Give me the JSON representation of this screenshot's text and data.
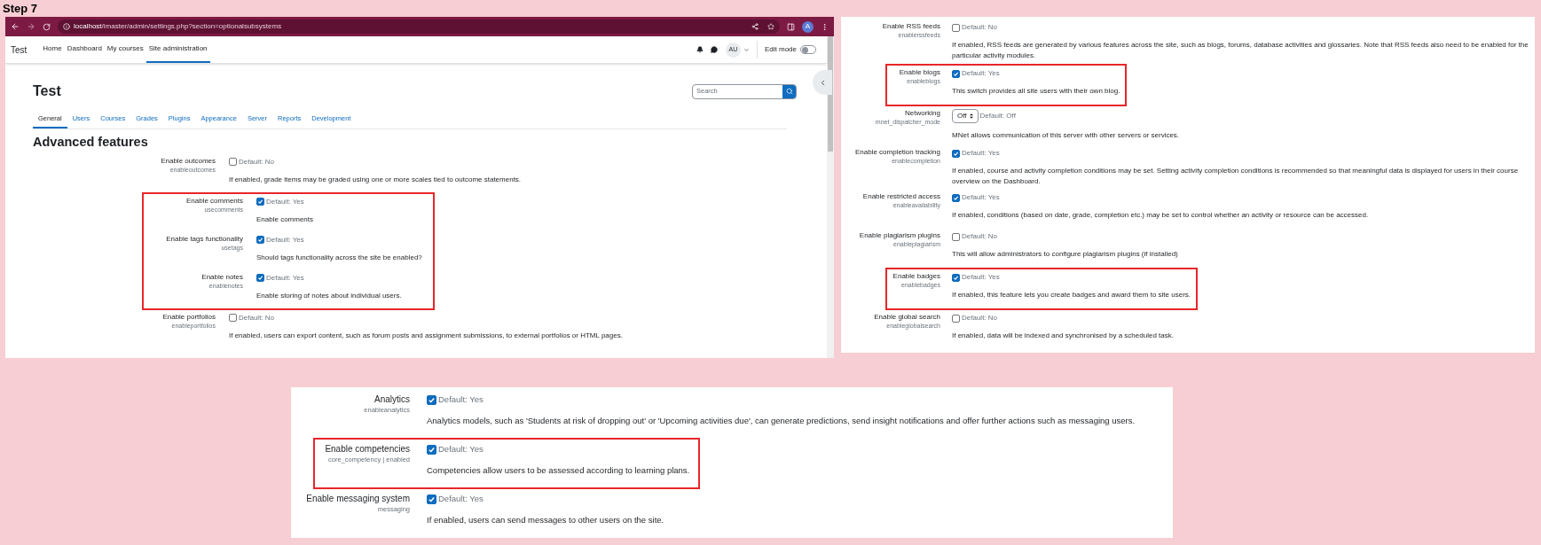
{
  "step_label": "Step 7",
  "browser": {
    "url_host": "localhost",
    "url_path": "/imaster/admin/settings.php?section=optionalsubsystems",
    "profile_initial": "A"
  },
  "navbar": {
    "brand": "Test",
    "items": [
      {
        "label": "Home",
        "selected": false
      },
      {
        "label": "Dashboard",
        "selected": false
      },
      {
        "label": "My courses",
        "selected": false
      },
      {
        "label": "Site administration",
        "selected": true
      }
    ],
    "user_initials": "AU",
    "edit_mode": {
      "label": "Edit mode",
      "on": false
    }
  },
  "page": {
    "title": "Test",
    "search": {
      "placeholder": "Search"
    },
    "tabs": [
      {
        "label": "General",
        "selected": true
      },
      {
        "label": "Users",
        "selected": false
      },
      {
        "label": "Courses",
        "selected": false
      },
      {
        "label": "Grades",
        "selected": false
      },
      {
        "label": "Plugins",
        "selected": false
      },
      {
        "label": "Appearance",
        "selected": false
      },
      {
        "label": "Server",
        "selected": false
      },
      {
        "label": "Reports",
        "selected": false
      },
      {
        "label": "Development",
        "selected": false
      }
    ],
    "section_title": "Advanced features",
    "settings": [
      {
        "kind": "checkbox",
        "label": "Enable outcomes",
        "name": "enableoutcomes",
        "checked": false,
        "default": "Default: No",
        "description": "If enabled, grade items may be graded using one or more scales tied to outcome statements.",
        "highlighted": false
      },
      {
        "kind": "checkbox",
        "label": "Enable comments",
        "name": "usecomments",
        "checked": true,
        "default": "Default: Yes",
        "description": "Enable comments",
        "highlighted": true
      },
      {
        "kind": "checkbox",
        "label": "Enable tags functionality",
        "name": "usetags",
        "checked": true,
        "default": "Default: Yes",
        "description": "Should tags functionality across the site be enabled?",
        "highlighted": true
      },
      {
        "kind": "checkbox",
        "label": "Enable notes",
        "name": "enablenotes",
        "checked": true,
        "default": "Default: Yes",
        "description": "Enable storing of notes about individual users.",
        "highlighted": true
      },
      {
        "kind": "checkbox",
        "label": "Enable portfolios",
        "name": "enableportfolios",
        "checked": false,
        "default": "Default: No",
        "description": "If enabled, users can export content, such as forum posts and assignment submissions, to external portfolios or HTML pages.",
        "highlighted": false
      }
    ]
  },
  "panel_2": {
    "settings": [
      {
        "kind": "checkbox",
        "label": "Enable RSS feeds",
        "name": "enablerssfeeds",
        "checked": false,
        "default": "Default: No",
        "description": "If enabled, RSS feeds are generated by various features across the site, such as blogs, forums, database activities and glossaries. Note that RSS feeds also need to be enabled for the particular activity modules.",
        "highlighted": false
      },
      {
        "kind": "checkbox",
        "label": "Enable blogs",
        "name": "enableblogs",
        "checked": true,
        "default": "Default: Yes",
        "description": "This switch provides all site users with their own blog.",
        "highlighted": true
      },
      {
        "kind": "select",
        "label": "Networking",
        "name": "mnet_dispatcher_mode",
        "value": "Off",
        "default": "Default: Off",
        "description": "MNet allows communication of this server with other servers or services.",
        "highlighted": false
      },
      {
        "kind": "checkbox",
        "label": "Enable completion tracking",
        "name": "enablecompletion",
        "checked": true,
        "default": "Default: Yes",
        "description": "If enabled, course and activity completion conditions may be set. Setting activity completion conditions is recommended so that meaningful data is displayed for users in their course overview on the Dashboard.",
        "highlighted": false
      },
      {
        "kind": "checkbox",
        "label": "Enable restricted access",
        "name": "enableavailability",
        "checked": true,
        "default": "Default: Yes",
        "description": "If enabled, conditions (based on date, grade, completion etc.) may be set to control whether an activity or resource can be accessed.",
        "highlighted": false
      },
      {
        "kind": "checkbox",
        "label": "Enable plagiarism plugins",
        "name": "enableplagiarism",
        "checked": false,
        "default": "Default: No",
        "description": "This will allow administrators to configure plagiarism plugins (if installed)",
        "highlighted": false
      },
      {
        "kind": "checkbox",
        "label": "Enable badges",
        "name": "enablebadges",
        "checked": true,
        "default": "Default: Yes",
        "description": "If enabled, this feature lets you create badges and award them to site users.",
        "highlighted": true
      },
      {
        "kind": "checkbox",
        "label": "Enable global search",
        "name": "enableglobalsearch",
        "checked": false,
        "default": "Default: No",
        "description": "If enabled, data will be indexed and synchronised by a scheduled task.",
        "highlighted": false
      }
    ]
  },
  "panel_3": {
    "settings": [
      {
        "kind": "checkbox",
        "label": "Analytics",
        "name": "enableanalytics",
        "checked": true,
        "default": "Default: Yes",
        "description": "Analytics models, such as 'Students at risk of dropping out' or 'Upcoming activities due', can generate predictions, send insight notifications and offer further actions such as messaging users.",
        "highlighted": false
      },
      {
        "kind": "checkbox",
        "label": "Enable competencies",
        "name": "core_competency | enabled",
        "checked": true,
        "default": "Default: Yes",
        "description": "Competencies allow users to be assessed according to learning plans.",
        "highlighted": true
      },
      {
        "kind": "checkbox",
        "label": "Enable messaging system",
        "name": "messaging",
        "checked": true,
        "default": "Default: Yes",
        "description": "If enabled, users can send messages to other users on the site.",
        "highlighted": false
      }
    ]
  }
}
